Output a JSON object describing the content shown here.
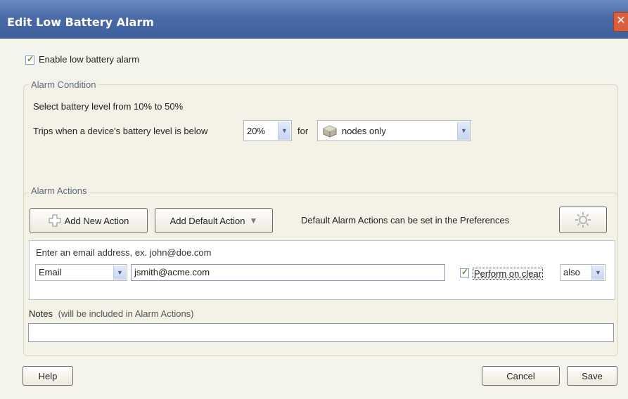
{
  "window": {
    "title": "Edit Low Battery Alarm",
    "close_glyph": "✕"
  },
  "enable": {
    "label": "Enable low battery alarm",
    "checked": true
  },
  "condition": {
    "legend": "Alarm Condition",
    "hint": "Select battery level from 10% to 50%",
    "trips_label": "Trips when a device's battery level is below",
    "level_value": "20%",
    "for_label": "for",
    "target_value": "nodes only",
    "target_icon": "node-cube-icon"
  },
  "actions": {
    "legend": "Alarm Actions",
    "add_new_label": "Add New Action",
    "add_default_label": "Add Default Action",
    "prefs_text": "Default Alarm Actions can be set in the Preferences",
    "email_hint": "Enter an email address, ex. john@doe.com",
    "type_value": "Email",
    "email_value": "jsmith@acme.com",
    "perform_clear_label": "Perform on clear",
    "perform_clear_checked": true,
    "clear_mode_value": "also"
  },
  "notes": {
    "label": "Notes",
    "sub_label": "(will be included in Alarm Actions)",
    "value": ""
  },
  "footer": {
    "help_label": "Help",
    "cancel_label": "Cancel",
    "save_label": "Save"
  },
  "colors": {
    "title_bar": "#4a6aa8",
    "legend_text": "#5c6a84",
    "close_button": "#d9603b"
  }
}
